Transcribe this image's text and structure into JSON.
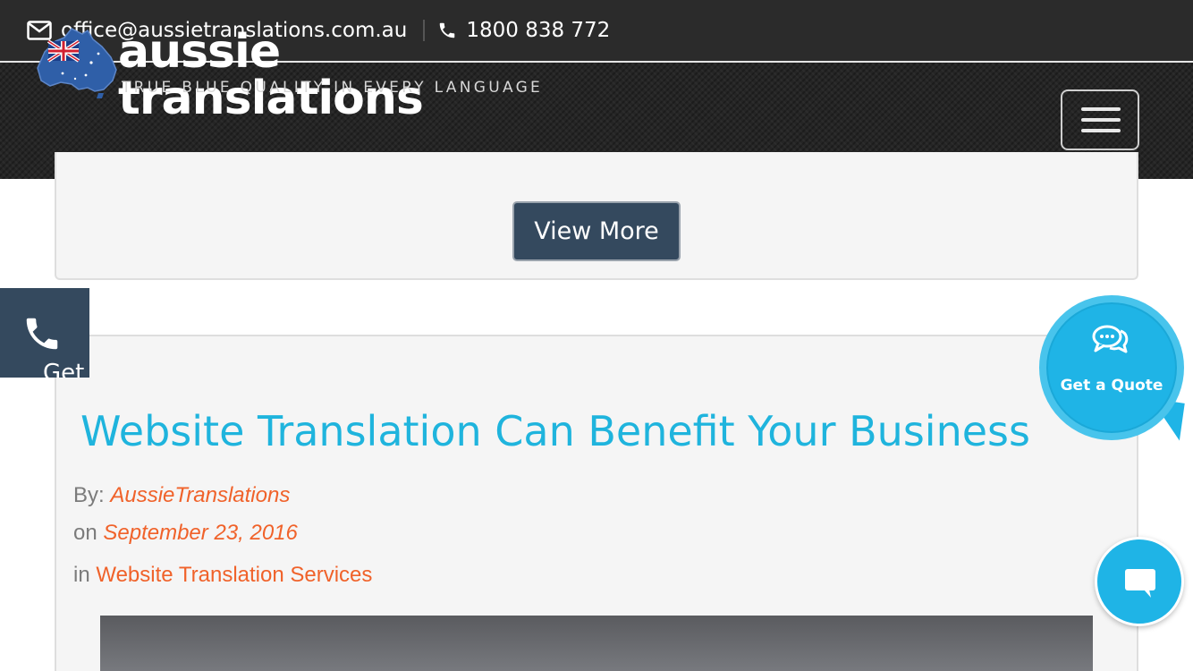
{
  "topbar": {
    "email": "office@aussietranslations.com.au",
    "phone": "1800 838 772",
    "email_icon": "envelope-icon",
    "phone_icon": "phone-icon"
  },
  "header": {
    "logo_text": "aussie translations",
    "tagline": "TRUE BLUE QUALITY IN EVERY LANGUAGE",
    "menu_icon": "hamburger-menu-icon"
  },
  "previous_card": {
    "view_more_label": "View More"
  },
  "side_call": {
    "label": "Get",
    "icon": "phone-icon"
  },
  "post": {
    "title": "Website Translation Can Benefit Your Business",
    "by_label": "By:",
    "author": "AussieTranslations",
    "on_label": "on",
    "date": "September 23, 2016",
    "in_label": "in",
    "category": "Website Translation Services"
  },
  "quote_bubble": {
    "label": "Get a Quote",
    "icon": "chat-bubbles-icon"
  },
  "chat": {
    "icon": "chat-icon"
  },
  "colors": {
    "topbar_bg": "#2b2b2b",
    "header_bg": "#252525",
    "button_bg": "#34495e",
    "title_blue": "#1fb4dd",
    "accent_orange": "#f0622a",
    "bubble_blue": "#1fb4e6"
  }
}
